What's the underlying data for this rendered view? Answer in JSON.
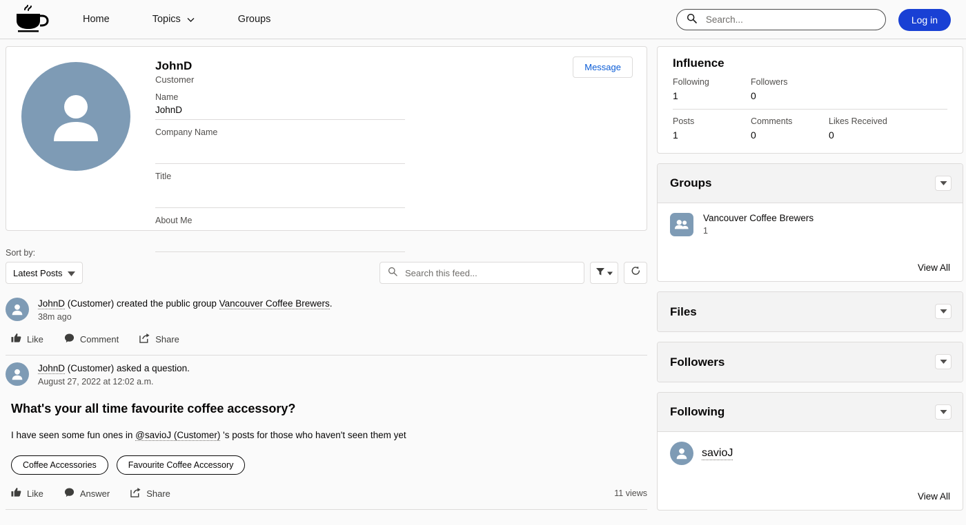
{
  "header": {
    "logo_icon": "coffee-cup-logo",
    "nav": [
      {
        "label": "Home",
        "icon": null
      },
      {
        "label": "Topics",
        "icon": "chevron-down-icon"
      },
      {
        "label": "Groups",
        "icon": null
      }
    ],
    "search": {
      "placeholder": "Search...",
      "value": "",
      "icon": "search-icon"
    },
    "login_label": "Log in"
  },
  "profile": {
    "avatar_icon": "user-avatar",
    "name": "JohnD",
    "role": "Customer",
    "message_button": "Message",
    "fields": [
      {
        "label": "Name",
        "value": "JohnD"
      },
      {
        "label": "Company Name",
        "value": ""
      },
      {
        "label": "Title",
        "value": ""
      },
      {
        "label": "About Me",
        "value": ""
      }
    ]
  },
  "feed_toolbar": {
    "sort_label": "Sort by:",
    "sort_value": "Latest Posts",
    "search": {
      "placeholder": "Search this feed...",
      "value": "",
      "icon": "search-icon"
    },
    "filter_icon": "filter-funnel-icon",
    "refresh_icon": "refresh-icon"
  },
  "feed": {
    "posts": [
      {
        "author": "JohnD",
        "author_suffix": " (Customer) created the public group ",
        "link": "Vancouver Coffee Brewers",
        "suffix_end": ".",
        "time": "38m ago",
        "title": "",
        "body": "",
        "topics": [],
        "actions": [
          {
            "label": "Like",
            "icon": "thumbs-up-icon"
          },
          {
            "label": "Comment",
            "icon": "comment-bubble-icon"
          },
          {
            "label": "Share",
            "icon": "share-icon"
          }
        ],
        "views": ""
      },
      {
        "author": "JohnD",
        "author_suffix": " (Customer) asked a question.",
        "link": "",
        "suffix_end": "",
        "time": "August 27, 2022 at 12:02 a.m.",
        "title": "What's your all time favourite coffee accessory?",
        "body_pre": "I have seen some fun ones in ",
        "body_mention": "@savioJ (Customer)",
        "body_post": " 's posts for those who haven't seen them yet",
        "topics": [
          "Coffee Accessories",
          "Favourite Coffee Accessory"
        ],
        "actions": [
          {
            "label": "Like",
            "icon": "thumbs-up-icon"
          },
          {
            "label": "Answer",
            "icon": "comment-bubble-icon"
          },
          {
            "label": "Share",
            "icon": "share-icon"
          }
        ],
        "views": "11 views"
      }
    ]
  },
  "sidebar": {
    "influence": {
      "title": "Influence",
      "row1": [
        {
          "label": "Following",
          "value": "1"
        },
        {
          "label": "Followers",
          "value": "0"
        }
      ],
      "row2": [
        {
          "label": "Posts",
          "value": "1"
        },
        {
          "label": "Comments",
          "value": "0"
        },
        {
          "label": "Likes Received",
          "value": "0"
        }
      ]
    },
    "groups": {
      "title": "Groups",
      "caret_icon": "caret-down-icon",
      "items": [
        {
          "name": "Vancouver Coffee Brewers",
          "count": "1",
          "icon": "group-people-icon"
        }
      ],
      "view_all": "View All"
    },
    "files": {
      "title": "Files",
      "caret_icon": "caret-down-icon"
    },
    "followers": {
      "title": "Followers",
      "caret_icon": "caret-down-icon"
    },
    "following": {
      "title": "Following",
      "caret_icon": "caret-down-icon",
      "items": [
        {
          "name": "savioJ",
          "icon": "user-avatar"
        }
      ],
      "view_all": "View All"
    }
  },
  "colors": {
    "accent_blue": "#1940d4",
    "link_blue": "#0b5cd6",
    "avatar": "#7e9bb5",
    "panel_header": "#f3f3f3",
    "border": "#dddbda"
  }
}
